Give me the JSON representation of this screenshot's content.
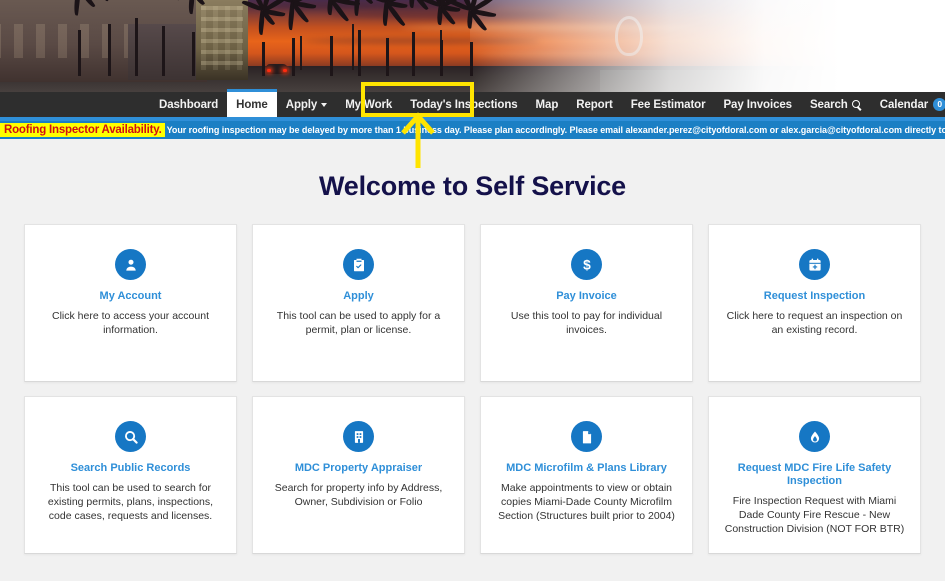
{
  "hero": {
    "alt": "Sunset cityscape of downtown Doral with palm trees and city hall building"
  },
  "nav": {
    "items": [
      {
        "label": "Dashboard",
        "type": "link",
        "active": false
      },
      {
        "label": "Home",
        "type": "link",
        "active": true
      },
      {
        "label": "Apply",
        "type": "dropdown",
        "active": false
      },
      {
        "label": "My Work",
        "type": "link",
        "active": false
      },
      {
        "label": "Today's Inspections",
        "type": "link",
        "active": false
      },
      {
        "label": "Map",
        "type": "link",
        "active": false
      },
      {
        "label": "Report",
        "type": "link",
        "active": false
      },
      {
        "label": "Fee Estimator",
        "type": "link",
        "active": false
      },
      {
        "label": "Pay Invoices",
        "type": "link",
        "active": false
      },
      {
        "label": "Search",
        "type": "search",
        "active": false
      },
      {
        "label": "Calendar",
        "type": "badge",
        "badge": "0",
        "active": false
      }
    ]
  },
  "alert": {
    "tag": "Roofing Inspector Availability.",
    "message": "Your roofing inspection may be delayed by more than 1 business day. Please plan accordingly. Please email alexander.perez@cityofdoral.com or alex.garcia@cityofdoral.com directly to confirm availability.",
    "background_color": "#1b7fc4",
    "tag_background_color": "#ffff00",
    "tag_text_color": "#d01111"
  },
  "main": {
    "title": "Welcome to Self Service",
    "cards": [
      {
        "icon": "user-icon",
        "title": "My Account",
        "desc": "Click here to access your account information."
      },
      {
        "icon": "clipboard-check-icon",
        "title": "Apply",
        "desc": "This tool can be used to apply for a permit, plan or license."
      },
      {
        "icon": "dollar-icon",
        "title": "Pay Invoice",
        "desc": "Use this tool to pay for individual invoices."
      },
      {
        "icon": "calendar-plus-icon",
        "title": "Request Inspection",
        "desc": "Click here to request an inspection on an existing record."
      },
      {
        "icon": "magnifier-icon",
        "title": "Search Public Records",
        "desc": "This tool can be used to search for existing permits, plans, inspections, code cases, requests and licenses."
      },
      {
        "icon": "building-icon",
        "title": "MDC Property Appraiser",
        "desc": "Search for property info by Address, Owner, Subdivision or Folio"
      },
      {
        "icon": "document-icon",
        "title": "MDC Microfilm & Plans Library",
        "desc": "Make appointments to view or obtain copies Miami-Dade County Microfilm Section (Structures built prior to 2004)"
      },
      {
        "icon": "flame-drop-icon",
        "title": "Request MDC Fire Life Safety Inspection",
        "desc": "Fire Inspection Request with Miami Dade County Fire Rescue - New Construction Division (NOT FOR BTR)"
      }
    ]
  },
  "annotation": {
    "highlight_target": "Today's Inspections",
    "color": "#ffe400",
    "arrow_direction": "up"
  },
  "theme": {
    "nav_background": "#2e2e2e",
    "accent_blue": "#2f8fd8",
    "icon_blue": "#1677c4",
    "title_color": "#14114a",
    "page_background": "#f1f1f1"
  }
}
